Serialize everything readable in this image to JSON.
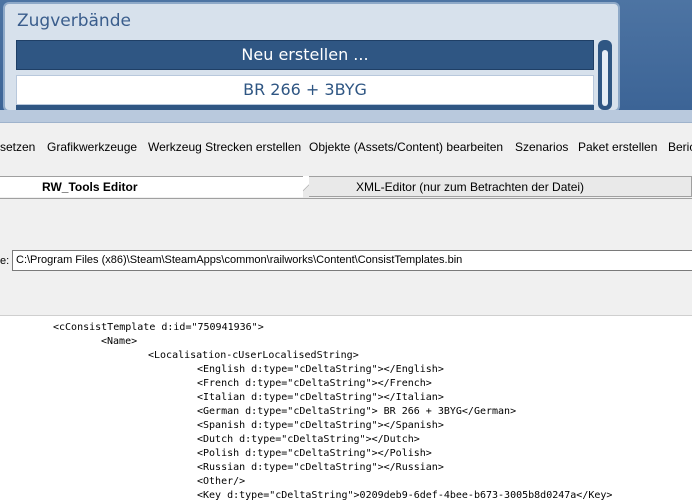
{
  "game_panel": {
    "title": "Zugverbände",
    "new_button": "Neu erstellen ...",
    "consist_item": "BR 266 + 3BYG"
  },
  "menu": {
    "items": [
      "setzen",
      "Grafikwerkzeuge",
      "Werkzeug Strecken erstellen",
      "Objekte (Assets/Content) bearbeiten",
      "Szenarios",
      "Paket erstellen",
      "Beric"
    ]
  },
  "tabs": {
    "active": "RW_Tools Editor",
    "inactive": "XML-Editor (nur zum Betrachten der Datei)"
  },
  "file": {
    "label": "e:",
    "path": "C:\\Program Files (x86)\\Steam\\SteamApps\\common\\railworks\\Content\\ConsistTemplates.bin"
  },
  "xml_lines": [
    "<cConsistTemplate d:id=\"750941936\">",
    "<Name>",
    "<Localisation-cUserLocalisedString>",
    "<English d:type=\"cDeltaString\"></English>",
    "<French d:type=\"cDeltaString\"></French>",
    "<Italian d:type=\"cDeltaString\"></Italian>",
    "<German d:type=\"cDeltaString\"> BR 266 + 3BYG</German>",
    "<Spanish d:type=\"cDeltaString\"></Spanish>",
    "<Dutch d:type=\"cDeltaString\"></Dutch>",
    "<Polish d:type=\"cDeltaString\"></Polish>",
    "<Russian d:type=\"cDeltaString\"></Russian>",
    "<Other/>",
    "<Key d:type=\"cDeltaString\">0209deb9-6def-4bee-b673-3005b8d0247a</Key>"
  ]
}
